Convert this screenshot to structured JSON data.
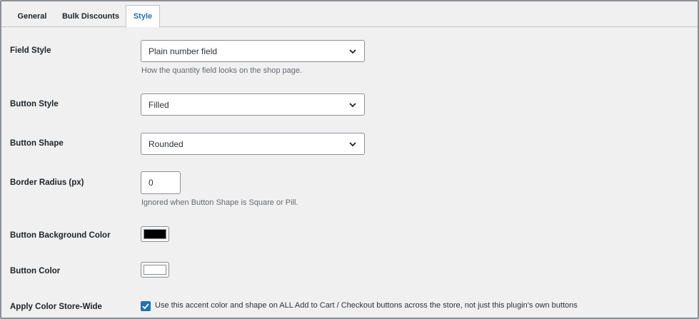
{
  "tabs": [
    {
      "label": "General"
    },
    {
      "label": "Bulk Discounts"
    },
    {
      "label": "Style"
    }
  ],
  "active_tab": "Style",
  "fields": {
    "field_style": {
      "label": "Field Style",
      "value": "Plain number field",
      "help": "How the quantity field looks on the shop page."
    },
    "button_style": {
      "label": "Button Style",
      "value": "Filled"
    },
    "button_shape": {
      "label": "Button Shape",
      "value": "Rounded"
    },
    "border_radius": {
      "label": "Border Radius (px)",
      "value": "0",
      "help": "Ignored when Button Shape is Square or Pill."
    },
    "button_bg_color": {
      "label": "Button Background Color",
      "color": "#000000"
    },
    "button_color": {
      "label": "Button Color",
      "color": "#ffffff"
    },
    "apply_store_wide": {
      "label": "Apply Color Store-Wide",
      "checked": true,
      "description": "Use this accent color and shape on ALL Add to Cart / Checkout buttons across the store, not just this plugin's own buttons"
    }
  },
  "icons": {
    "select_chevron": "chevron-down-icon",
    "checkbox_check": "checkmark-icon"
  },
  "colors": {
    "accent": "#2271b1",
    "background": "#f0f0f1"
  }
}
